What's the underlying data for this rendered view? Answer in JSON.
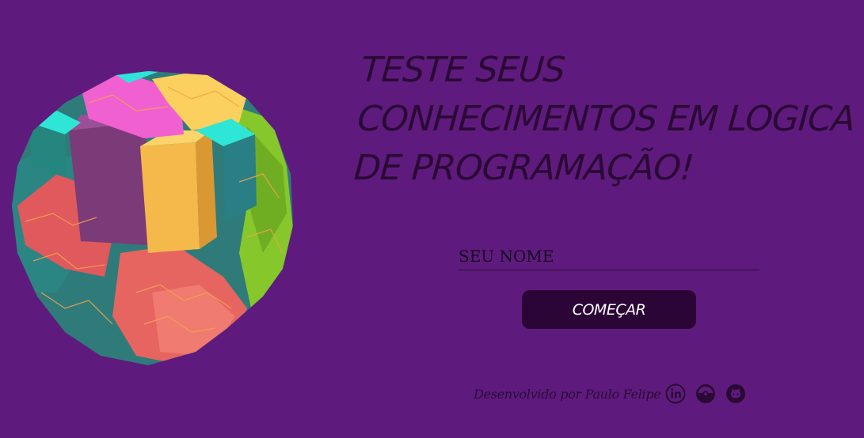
{
  "hero": {
    "headline_lines": [
      "TESTE SEUS",
      "CONHECIMENTOS EM LOGICA",
      "DE PROGRAMAÇÃO!"
    ]
  },
  "form": {
    "name_placeholder": "SEU NOME",
    "start_label": "COMEÇAR"
  },
  "footer": {
    "credit": "Desenvolvido por Paulo Felipe",
    "icons": [
      "linkedin-icon",
      "pokeball-icon",
      "github-icon"
    ]
  },
  "colors": {
    "background": "#5e1b7d",
    "text": "#2a0a35",
    "button": "#2b0536",
    "button_text": "#ffffff"
  }
}
